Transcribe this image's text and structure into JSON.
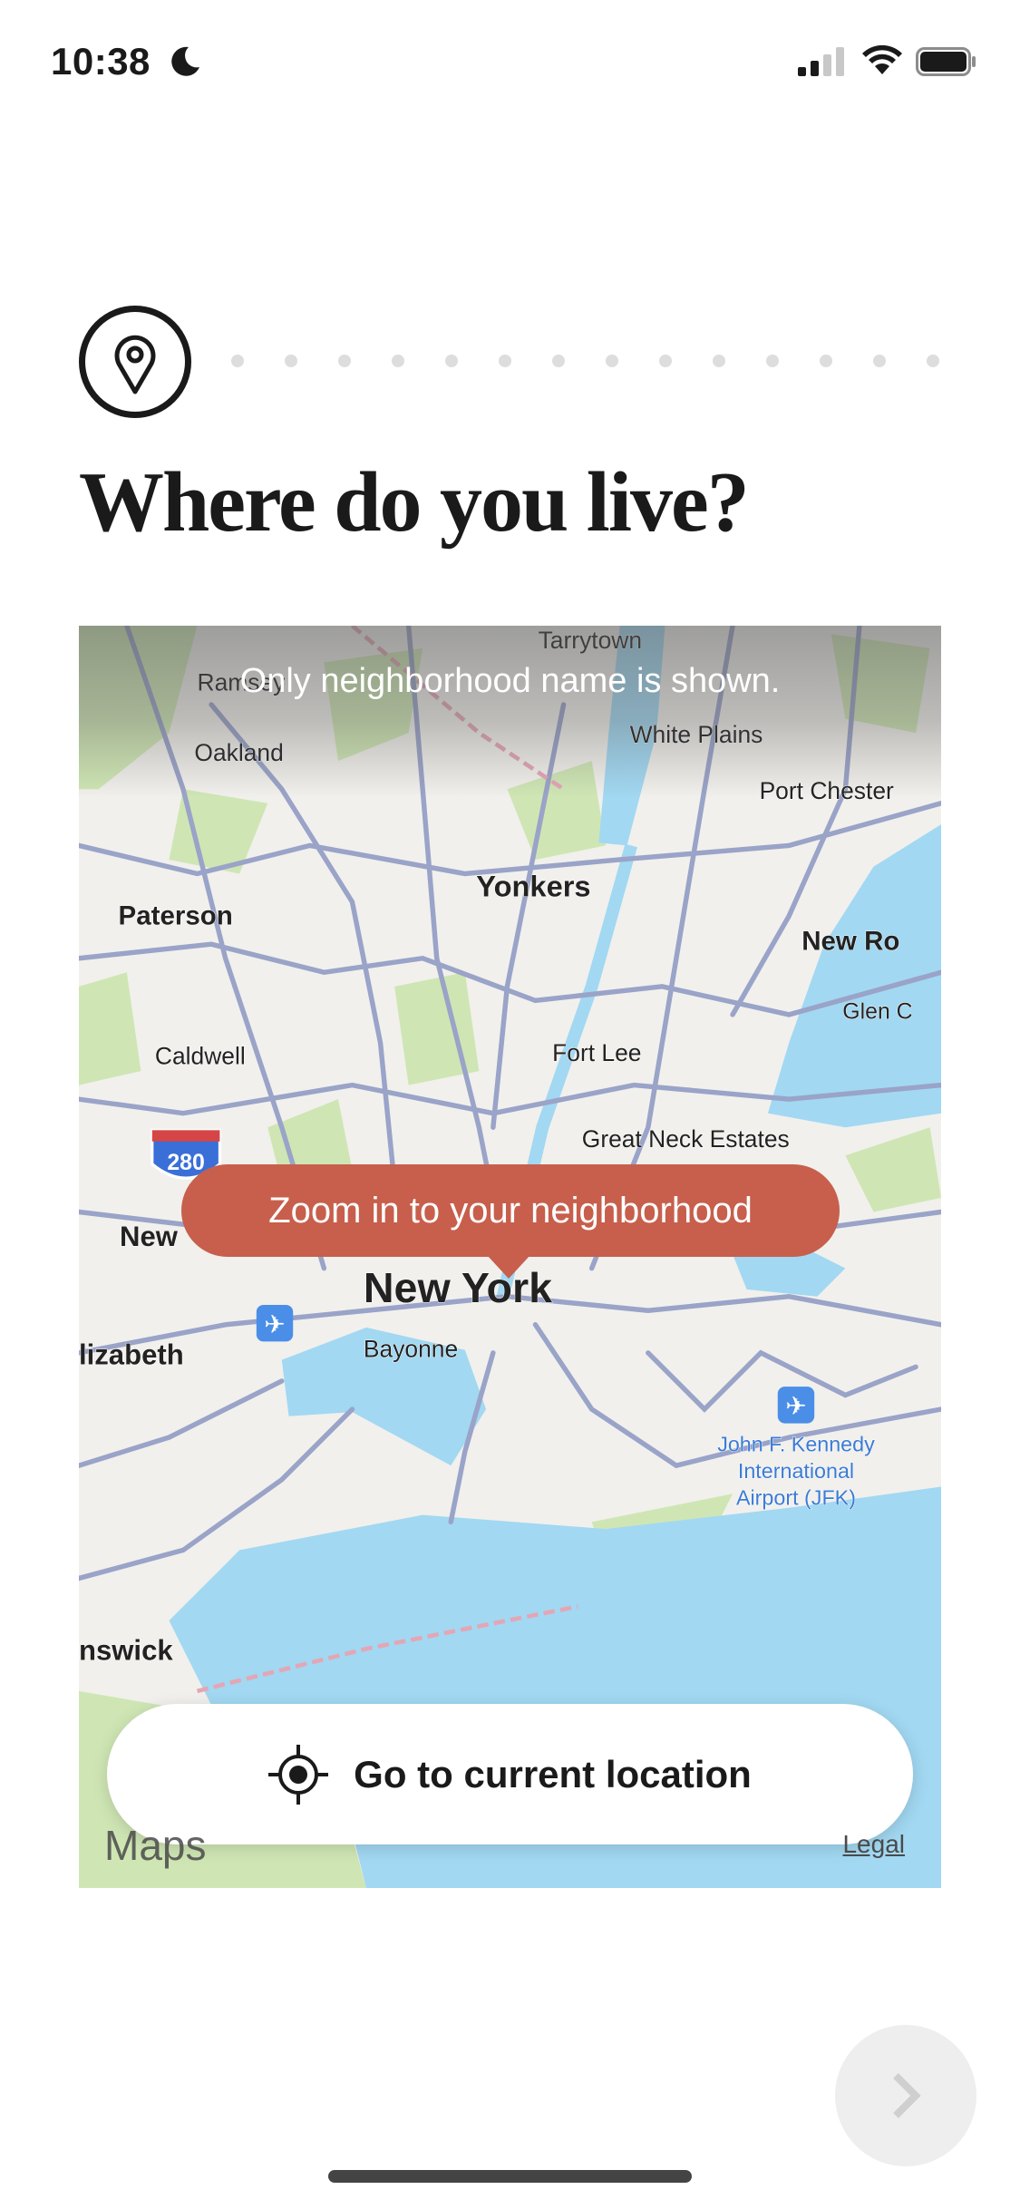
{
  "status_bar": {
    "time": "10:38",
    "icons": [
      "moon-icon",
      "cellular-signal-icon",
      "wifi-icon",
      "battery-icon"
    ]
  },
  "progress": {
    "icon": "map-pin-icon",
    "current_step": 1,
    "total_steps": 15
  },
  "title": "Where do you live?",
  "map": {
    "banner": "Only neighborhood name is shown.",
    "tooltip": "Zoom in to your neighborhood",
    "labels": [
      "Tarrytown",
      "White Plains",
      "Oakland",
      "Port Chester",
      "Yonkers",
      "Paterson",
      "New Ro",
      "Glen C",
      "Caldwell",
      "Fort Lee",
      "Great Neck Estates",
      "New York",
      "New",
      "Bayonne",
      "lizabeth",
      "John F. Kennedy",
      "International",
      "Airport (JFK)",
      "nswick",
      "Ramsey"
    ],
    "highway_shields": [
      "280"
    ],
    "attribution": "Maps",
    "legal": "Legal",
    "colors": {
      "water": "#a2d8f2",
      "park": "#cfe6b4",
      "road": "#9aa3c8",
      "land": "#f1f0ec"
    }
  },
  "current_location_button": {
    "label": "Go to current location",
    "icon": "crosshair-icon"
  },
  "next_button": {
    "icon": "chevron-right-icon",
    "enabled": false
  },
  "accent_color": "#c75f4c"
}
